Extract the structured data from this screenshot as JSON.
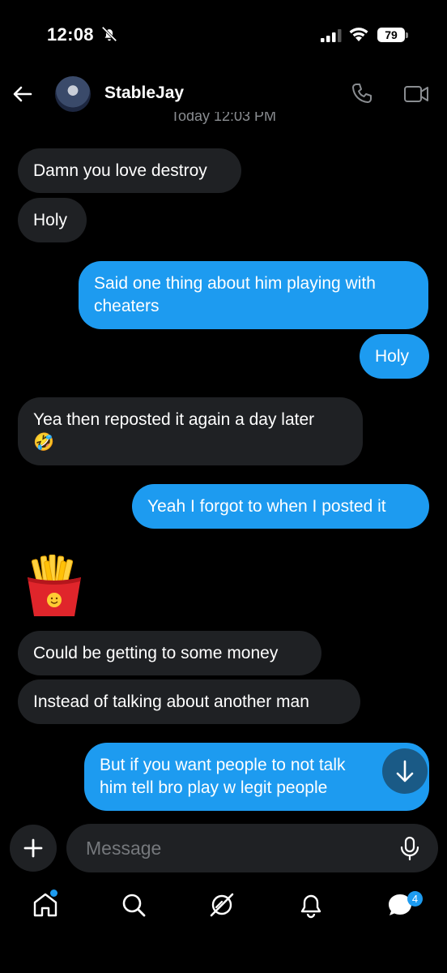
{
  "status_bar": {
    "time": "12:08",
    "battery": "79"
  },
  "header": {
    "contact_name": "StableJay",
    "timestamp": "Today 12:03 PM"
  },
  "messages": [
    {
      "text": "Damn you love destroy",
      "direction": "incoming"
    },
    {
      "text": "Holy",
      "direction": "incoming"
    },
    {
      "text": "Said one thing about him playing with cheaters",
      "direction": "outgoing"
    },
    {
      "text": "Holy",
      "direction": "outgoing"
    },
    {
      "text": "Yea then reposted it again a day later",
      "emoji": "🤣",
      "direction": "incoming"
    },
    {
      "text": "Yeah I forgot to when I posted it",
      "direction": "outgoing"
    },
    {
      "emoji": "🍟",
      "direction": "incoming"
    },
    {
      "text": "Could be getting to some money",
      "direction": "incoming"
    },
    {
      "text": "Instead of talking about another man",
      "direction": "incoming"
    },
    {
      "text": "But if you want people to not talk him tell bro play w legit people",
      "direction": "outgoing"
    }
  ],
  "composer": {
    "placeholder": "Message"
  },
  "tab_bar": {
    "items": [
      "home-icon",
      "search-icon",
      "grok-icon",
      "notifications-icon",
      "messages-icon"
    ],
    "messages_badge": "4"
  },
  "colors": {
    "accent": "#1d9bf0",
    "incoming_bubble": "#1f2124",
    "background": "#000000"
  }
}
